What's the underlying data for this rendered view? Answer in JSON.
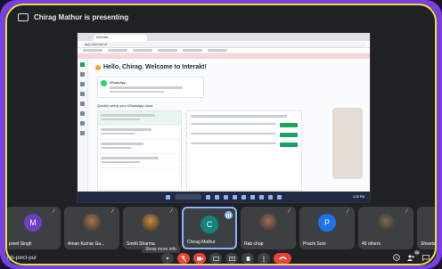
{
  "presenting": {
    "text": "Chirag Mathur is presenting"
  },
  "shared_screen": {
    "browser_tab": "Interakt",
    "address": "app.interakt.ai",
    "banner": "",
    "welcome": "Hello, Chirag. Welcome to Interakt!",
    "card_title": "WhatsApp",
    "setup_title": "Quickly setup your WhatsApp store",
    "time": "4:28 PM"
  },
  "participants": [
    {
      "name": "preet Singh",
      "initial": "M",
      "color": "#6d3fc6",
      "type": "initial"
    },
    {
      "name": "Aman Kumar Gu...",
      "initial": "",
      "color": "#a9764b",
      "type": "photo"
    },
    {
      "name": "Smriti Sharma",
      "initial": "",
      "color": "#c9893f",
      "type": "photo"
    },
    {
      "name": "Chirag Mathur",
      "initial": "C",
      "color": "#12857a",
      "type": "initial",
      "highlight": true
    },
    {
      "name": "Rab chop",
      "initial": "",
      "color": "#9a6f5a",
      "type": "photo"
    },
    {
      "name": "Prachi Soni",
      "initial": "P",
      "color": "#1a73e8",
      "type": "initial"
    },
    {
      "name": "46 others",
      "initial": "",
      "color": "#7a6a55",
      "type": "photo"
    },
    {
      "name": "Shweta Sanwar",
      "initial": "",
      "color": "#b38b6d",
      "type": "photo"
    }
  ],
  "tooltip": "Show more info",
  "meeting_code": "ngh-pwct-pur",
  "controls": {
    "mic_icon": "mic-off-icon",
    "cam_icon": "cam-off-icon",
    "cc_icon": "captions-icon",
    "present_icon": "present-icon",
    "hand_icon": "hand-icon",
    "more_icon": "more-icon",
    "end_icon": "end-call-icon"
  },
  "people_count": "56"
}
